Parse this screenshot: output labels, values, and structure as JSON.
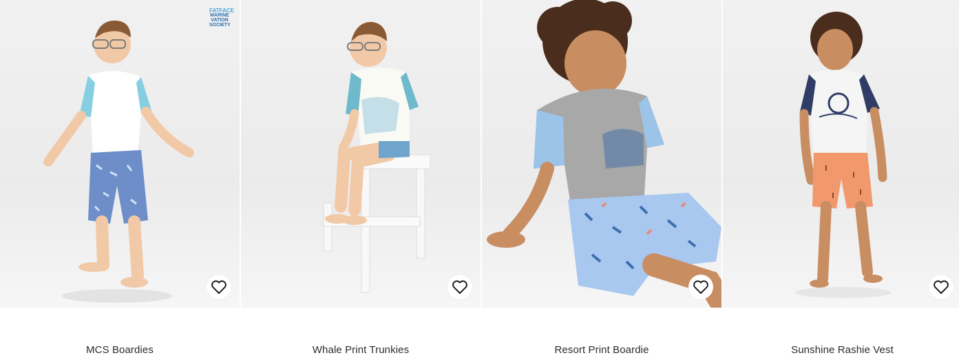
{
  "products": [
    {
      "title": "MCS Boardies",
      "badge": {
        "line1": "FATFACE",
        "line2": "MARINE",
        "line3": "VATION",
        "line4": "SOCIETY"
      }
    },
    {
      "title": "Whale Print Trunkies"
    },
    {
      "title": "Resort Print Boardie"
    },
    {
      "title": "Sunshine Rashie Vest"
    }
  ],
  "icons": {
    "favourite": "heart-outline-icon"
  },
  "colors": {
    "heart_stroke": "#1f1f1f",
    "title_text": "#2b2b2b"
  }
}
